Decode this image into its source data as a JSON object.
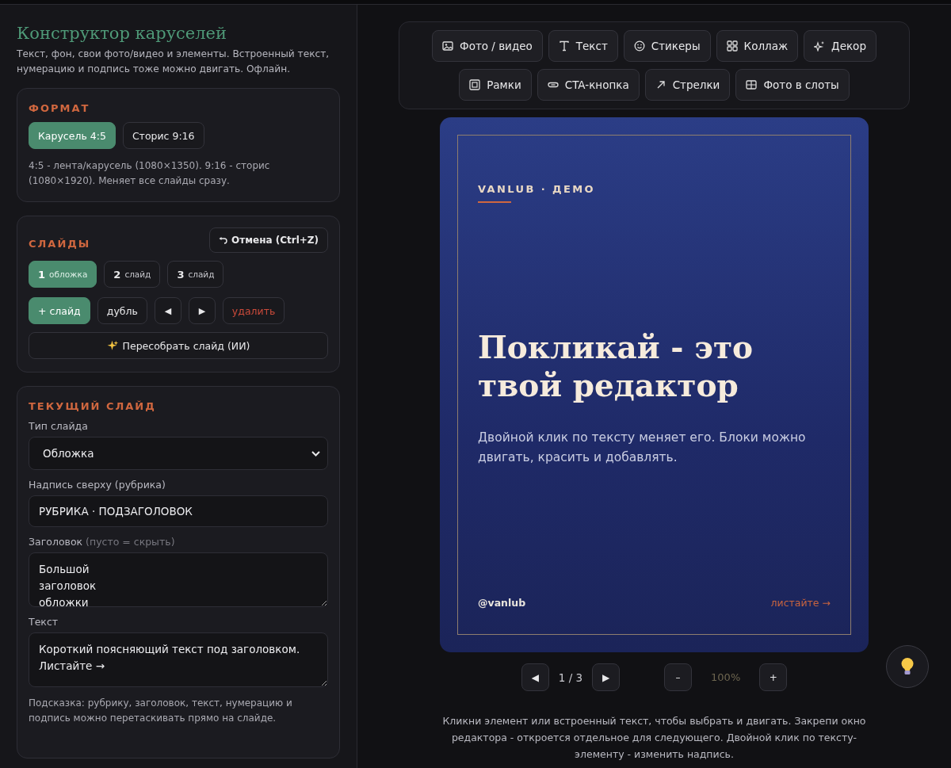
{
  "header": {
    "title": "Конструктор каруселей",
    "subtitle": "Текст, фон, свои фото/видео и элементы. Встроенный текст, нумерацию и подпись тоже можно двигать. Офлайн."
  },
  "format": {
    "heading": "ФОРМАТ",
    "options": [
      {
        "label": "Карусель 4:5",
        "selected": true
      },
      {
        "label": "Сторис 9:16",
        "selected": false
      }
    ],
    "note": "4:5 - лента/карусель (1080×1350). 9:16 - сторис (1080×1920). Меняет все слайды сразу."
  },
  "slides": {
    "heading": "СЛАЙДЫ",
    "undo": "Отмена (Ctrl+Z)",
    "items": [
      {
        "number": "1",
        "label": "обложка",
        "selected": true
      },
      {
        "number": "2",
        "label": "слайд",
        "selected": false
      },
      {
        "number": "3",
        "label": "слайд",
        "selected": false
      }
    ],
    "actions": [
      {
        "label": "+ слайд",
        "kind": "primary"
      },
      {
        "label": "дубль",
        "kind": "plain"
      },
      {
        "label": "◀",
        "kind": "arrow"
      },
      {
        "label": "▶",
        "kind": "arrow"
      },
      {
        "label": "удалить",
        "kind": "danger"
      }
    ],
    "rebuild": "Пересобрать слайд (ИИ)"
  },
  "current": {
    "heading": "ТЕКУЩИЙ СЛАЙД",
    "fields": [
      {
        "label": "Тип слайда",
        "kind": "select",
        "value": "Обложка"
      },
      {
        "label": "Надпись сверху (рубрика)",
        "kind": "input",
        "value": "РУБРИКА · ПОДЗАГОЛОВОК"
      },
      {
        "label": "Заголовок",
        "hint": "(пусто = скрыть)",
        "kind": "textarea",
        "value": "Большой\nзаголовок\nобложки"
      },
      {
        "label": "Текст",
        "kind": "textarea",
        "value": "Короткий поясняющий текст под заголовком.\nЛистайте →"
      }
    ],
    "tip": "Подсказка: рубрику, заголовок, текст, нумерацию и подпись можно перетаскивать прямо на слайде."
  },
  "toolbar": [
    [
      {
        "label": "Фото / видео",
        "kind": "image"
      },
      {
        "label": "Текст",
        "kind": "text"
      },
      {
        "label": "Стикеры",
        "kind": "smile"
      },
      {
        "label": "Коллаж",
        "kind": "grid"
      },
      {
        "label": "Декор",
        "kind": "sparkle"
      }
    ],
    [
      {
        "label": "Рамки",
        "kind": "frame"
      },
      {
        "label": "CTA-кнопка",
        "kind": "pill"
      },
      {
        "label": "Стрелки",
        "kind": "arrow"
      },
      {
        "label": "Фото в слоты",
        "kind": "slots"
      }
    ]
  ],
  "slide": {
    "rubric": "VANLUB · ДЕМО",
    "title": "Покликай - это твой редактор",
    "body": "Двойной клик по тексту меняет его. Блоки можно двигать, красить и добавлять.",
    "handle": "@vanlub",
    "swipe": "листайте →"
  },
  "pager": {
    "prev": "◀",
    "counter": "1 / 3",
    "next": "▶",
    "zoom_out": "–",
    "zoom": "100%",
    "zoom_in": "+"
  },
  "help": "Кликни элемент или встроенный текст, чтобы выбрать и двигать. Закрепи окно редактора - откроется отдельное для следующего. Двойной клик по тексту-элементу - изменить надпись."
}
